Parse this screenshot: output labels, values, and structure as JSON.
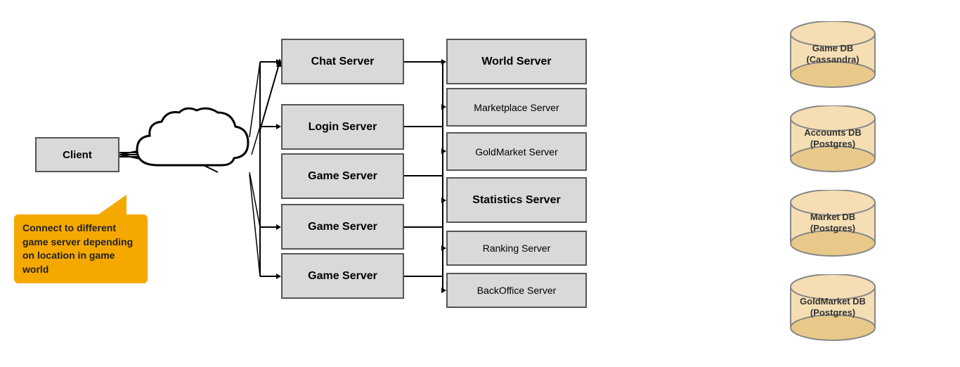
{
  "client": {
    "label": "Client"
  },
  "left_servers": [
    {
      "id": "chat",
      "label": "Chat Server",
      "bold": true
    },
    {
      "id": "login",
      "label": "Login Server",
      "bold": true
    },
    {
      "id": "game1",
      "label": "Game Server",
      "bold": true
    },
    {
      "id": "game2",
      "label": "Game Server",
      "bold": true
    },
    {
      "id": "game3",
      "label": "Game Server",
      "bold": true
    }
  ],
  "right_servers": [
    {
      "id": "world",
      "label": "World Server",
      "bold": true
    },
    {
      "id": "marketplace",
      "label": "Marketplace Server",
      "bold": false
    },
    {
      "id": "goldmarket",
      "label": "GoldMarket Server",
      "bold": false
    },
    {
      "id": "statistics",
      "label": "Statistics Server",
      "bold": true
    },
    {
      "id": "ranking",
      "label": "Ranking Server",
      "bold": false
    },
    {
      "id": "backoffice",
      "label": "BackOffice Server",
      "bold": false
    }
  ],
  "databases": [
    {
      "id": "game-db",
      "label": "Game DB\n(Cassandra)"
    },
    {
      "id": "accounts-db",
      "label": "Accounts DB\n(Postgres)"
    },
    {
      "id": "market-db",
      "label": "Market DB\n(Postgres)"
    },
    {
      "id": "goldmarket-db",
      "label": "GoldMarket DB\n(Postgres)"
    }
  ],
  "callout": {
    "text": "Connect to different game server depending on location in game world"
  }
}
